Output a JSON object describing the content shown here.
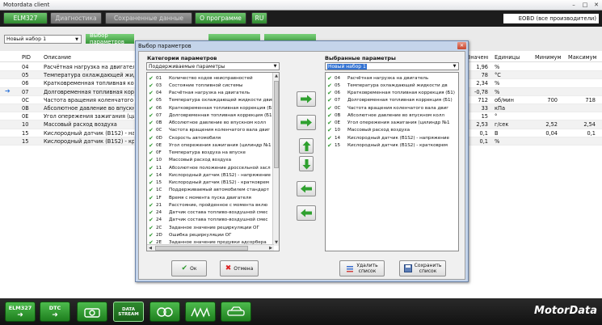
{
  "window": {
    "title": "Motordata client",
    "min": "–",
    "max": "□",
    "close": "✕"
  },
  "toolbar": {
    "buttons": [
      {
        "label": "ELM327"
      },
      {
        "label": "Диагностика"
      },
      {
        "label": "Сохраненные данные"
      },
      {
        "label": "О программе"
      },
      {
        "label": "RU"
      }
    ],
    "ecu": "EOBD (все производители)"
  },
  "setbar": {
    "set_select": "Новый набор 1",
    "params_button": "Выбор параметров"
  },
  "table": {
    "headers": {
      "pid": "PID",
      "desc": "Описание",
      "value": "Значение",
      "units": "Единицы",
      "min": "Минимум",
      "max": "Максимум"
    },
    "rows": [
      {
        "pid": "04",
        "desc": "Расчётная нагрузка на двигатель",
        "value": "1,96",
        "unit": "%",
        "min": "",
        "max": ""
      },
      {
        "pid": "05",
        "desc": "Температура охлаждающей жидкости",
        "value": "78",
        "unit": "°C",
        "min": "",
        "max": ""
      },
      {
        "pid": "06",
        "desc": "Кратковременная топливная коррекция",
        "value": "2,34",
        "unit": "%",
        "min": "",
        "max": ""
      },
      {
        "pid": "07",
        "desc": "Долговременная топливная коррекция",
        "value": "-0,78",
        "unit": "%",
        "min": "",
        "max": ""
      },
      {
        "pid": "0C",
        "desc": "Частота вращения коленчатого вала",
        "value": "712",
        "unit": "об/мин",
        "min": "700",
        "max": "718"
      },
      {
        "pid": "0B",
        "desc": "Абсолютное давление во впускном",
        "value": "33",
        "unit": "кПа",
        "min": "",
        "max": ""
      },
      {
        "pid": "0E",
        "desc": "Угол опережения зажигания (цилиндр",
        "value": "15",
        "unit": "°",
        "min": "",
        "max": ""
      },
      {
        "pid": "10",
        "desc": "Массовый расход воздуха",
        "value": "2,53",
        "unit": "г/сек",
        "min": "2,52",
        "max": "2,54"
      },
      {
        "pid": "15",
        "desc": "Кислородный датчик (B1S2) - напр",
        "value": "0,1",
        "unit": "В",
        "min": "0,04",
        "max": "0,1"
      },
      {
        "pid": "15",
        "desc": "Кислородный датчик (B1S2) - крат",
        "value": "0,1",
        "unit": "%",
        "min": "",
        "max": ""
      }
    ]
  },
  "dialog": {
    "title": "Выбор параметров",
    "close": "✕",
    "left_label": "Категории параметров",
    "left_combo": "Поддерживаемые параметры",
    "right_label": "Выбранные параметры",
    "right_combo": "Новый набор 1",
    "left_items": [
      {
        "pid": "01",
        "name": "Количество кодов неисправностей"
      },
      {
        "pid": "03",
        "name": "Состояние топливной системы"
      },
      {
        "pid": "04",
        "name": "Расчётная нагрузка на двигатель"
      },
      {
        "pid": "05",
        "name": "Температура охлаждающей жидкости двиг"
      },
      {
        "pid": "06",
        "name": "Кратковременная топливная коррекция (Б1"
      },
      {
        "pid": "07",
        "name": "Долговременная топливная коррекция (Б1)"
      },
      {
        "pid": "0B",
        "name": "Абсолютное давление во впускном колл"
      },
      {
        "pid": "0C",
        "name": "Частота вращения коленчатого вала двиг"
      },
      {
        "pid": "0D",
        "name": "Скорость автомобиля"
      },
      {
        "pid": "0E",
        "name": "Угол опережения зажигания (цилиндр №1"
      },
      {
        "pid": "0F",
        "name": "Температура воздуха на впуске"
      },
      {
        "pid": "10",
        "name": "Массовый расход воздуха"
      },
      {
        "pid": "11",
        "name": "Абсолютное положение дроссельной засл"
      },
      {
        "pid": "14",
        "name": "Кислородный датчик (B1S2) - напряжение"
      },
      {
        "pid": "15",
        "name": "Кислородный датчик (B1S2) - кратковрем"
      },
      {
        "pid": "1C",
        "name": "Поддерживаемый автомобилем стандарт"
      },
      {
        "pid": "1F",
        "name": "Время с момента пуска двигателя"
      },
      {
        "pid": "21",
        "name": "Расстояние, пройденное с момента вклю"
      },
      {
        "pid": "24",
        "name": "Датчик состава топливо-воздушной смес"
      },
      {
        "pid": "24",
        "name": "Датчик состава топливо-воздушной смес"
      },
      {
        "pid": "2C",
        "name": "Заданное значение рециркуляции ОГ"
      },
      {
        "pid": "2D",
        "name": "Ошибка рециркуляции ОГ"
      },
      {
        "pid": "2E",
        "name": "Заданное значение продувки адсорбера"
      }
    ],
    "right_items": [
      {
        "pid": "04",
        "name": "Расчётная нагрузка на двигатель"
      },
      {
        "pid": "05",
        "name": "Температура охлаждающей жидкости дв"
      },
      {
        "pid": "06",
        "name": "Кратковременная топливная коррекция (Б1)"
      },
      {
        "pid": "07",
        "name": "Долговременная топливная коррекция (Б1)"
      },
      {
        "pid": "0C",
        "name": "Частота вращения коленчатого вала двиг"
      },
      {
        "pid": "0B",
        "name": "Абсолютное давление во впускном колл"
      },
      {
        "pid": "0E",
        "name": "Угол опережения зажигания (цилиндр №1"
      },
      {
        "pid": "10",
        "name": "Массовый расход воздуха"
      },
      {
        "pid": "14",
        "name": "Кислородный датчик (B1S2) - напряжение"
      },
      {
        "pid": "15",
        "name": "Кислородный датчик (B1S2) - кратковрем"
      }
    ],
    "ok": "Ок",
    "cancel": "Отмена",
    "clear_list": "Удалить\nсписок",
    "save_list": "Сохранить\nсписок"
  },
  "bottom": {
    "buttons": [
      "ELM327",
      "DTC",
      "",
      "DATA STREAM",
      "",
      "",
      ""
    ],
    "brand": "MotorData"
  },
  "colors": {
    "accent_green": "#3a9a3a",
    "selection_blue": "#3373d3",
    "dialog_frame": "#c4d4ea"
  }
}
